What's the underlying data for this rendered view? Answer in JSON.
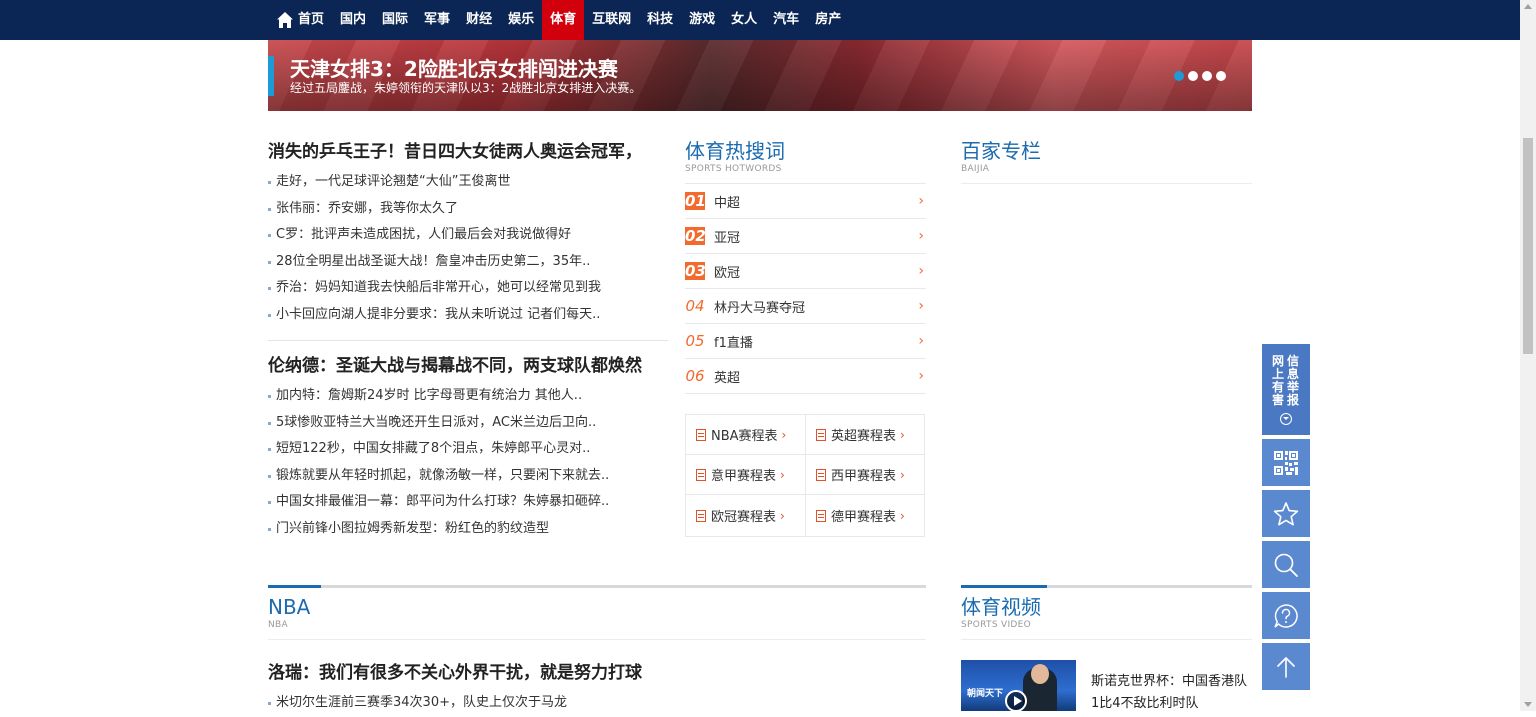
{
  "nav": {
    "items": [
      {
        "label": "首页",
        "active": false,
        "icon": "home-icon"
      },
      {
        "label": "国内",
        "active": false
      },
      {
        "label": "国际",
        "active": false
      },
      {
        "label": "军事",
        "active": false
      },
      {
        "label": "财经",
        "active": false
      },
      {
        "label": "娱乐",
        "active": false
      },
      {
        "label": "体育",
        "active": true
      },
      {
        "label": "互联网",
        "active": false
      },
      {
        "label": "科技",
        "active": false
      },
      {
        "label": "游戏",
        "active": false
      },
      {
        "label": "女人",
        "active": false
      },
      {
        "label": "汽车",
        "active": false
      },
      {
        "label": "房产",
        "active": false
      }
    ],
    "bg_color": "#0b2655",
    "active_color": "#d2000c"
  },
  "banner": {
    "title": "天津女排3：2险胜北京女排闯进决赛",
    "subtitle": "经过五局鏖战，朱婷领衔的天津队以3：2战胜北京女排进入决赛。",
    "active_dot": 1,
    "dot_count": 4
  },
  "news_block_1": {
    "headline": "消失的乒乓王子！昔日四大女徒两人奥运会冠军，",
    "items": [
      "走好，一代足球评论翘楚“大仙”王俊离世",
      "张伟丽：乔安娜，我等你太久了",
      "C罗：批评声未造成困扰，人们最后会对我说做得好",
      "28位全明星出战圣诞大战！詹皇冲击历史第二，35年..",
      "乔治：妈妈知道我去快船后非常开心，她可以经常见到我",
      "小卡回应向湖人提非分要求：我从未听说过 记者们每天.."
    ]
  },
  "news_block_2": {
    "headline": "伦纳德：圣诞大战与揭幕战不同，两支球队都焕然",
    "items": [
      "加内特：詹姆斯24岁时 比字母哥更有统治力 其他人..",
      "5球惨败亚特兰大当晚还开生日派对，AC米兰边后卫向..",
      "短短122秒，中国女排藏了8个泪点，朱婷郎平心灵对..",
      "锻炼就要从年轻时抓起，就像汤敏一样，只要闲下来就去..",
      "中国女排最催泪一幕：郎平问为什么打球？朱婷暴扣砸碎..",
      "门兴前锋小图拉姆秀新发型：粉红色的豹纹造型"
    ]
  },
  "hotwords": {
    "title": "体育热搜词",
    "subtitle": "SPORTS HOTWORDS",
    "items": [
      {
        "rank": "01",
        "word": "中超",
        "highlight": true
      },
      {
        "rank": "02",
        "word": "亚冠",
        "highlight": true
      },
      {
        "rank": "03",
        "word": "欧冠",
        "highlight": true
      },
      {
        "rank": "04",
        "word": "林丹大马赛夺冠",
        "highlight": false
      },
      {
        "rank": "05",
        "word": "f1直播",
        "highlight": false
      },
      {
        "rank": "06",
        "word": "英超",
        "highlight": false
      }
    ],
    "accent_color": "#f26a2e"
  },
  "schedules": [
    "NBA赛程表",
    "英超赛程表",
    "意甲赛程表",
    "西甲赛程表",
    "欧冠赛程表",
    "德甲赛程表"
  ],
  "baijia": {
    "title": "百家专栏",
    "subtitle": "BAIJIA"
  },
  "nba": {
    "title": "NBA",
    "subtitle": "NBA",
    "headline": "洛瑞：我们有很多不关心外界干扰，就是努力打球",
    "items": [
      "米切尔生涯前三赛季34次30+，队史上仅次于马龙"
    ]
  },
  "video": {
    "title": "体育视频",
    "subtitle": "SPORTS VIDEO",
    "item_title": "斯诺克世界杯：中国香港队1比4不敌比利时队",
    "thumb_logo": "朝闻天下"
  },
  "float_toolbar": {
    "report_text_col1": [
      "网",
      "上",
      "有",
      "害"
    ],
    "report_text_col2": [
      "信",
      "息",
      "举",
      "报"
    ],
    "buttons": [
      "qrcode-icon",
      "star-icon",
      "search-icon",
      "help-icon",
      "back-to-top-icon"
    ],
    "color": "#5b89d0"
  },
  "colors": {
    "accent": "#1a6bb0",
    "orange": "#f26a2e"
  }
}
